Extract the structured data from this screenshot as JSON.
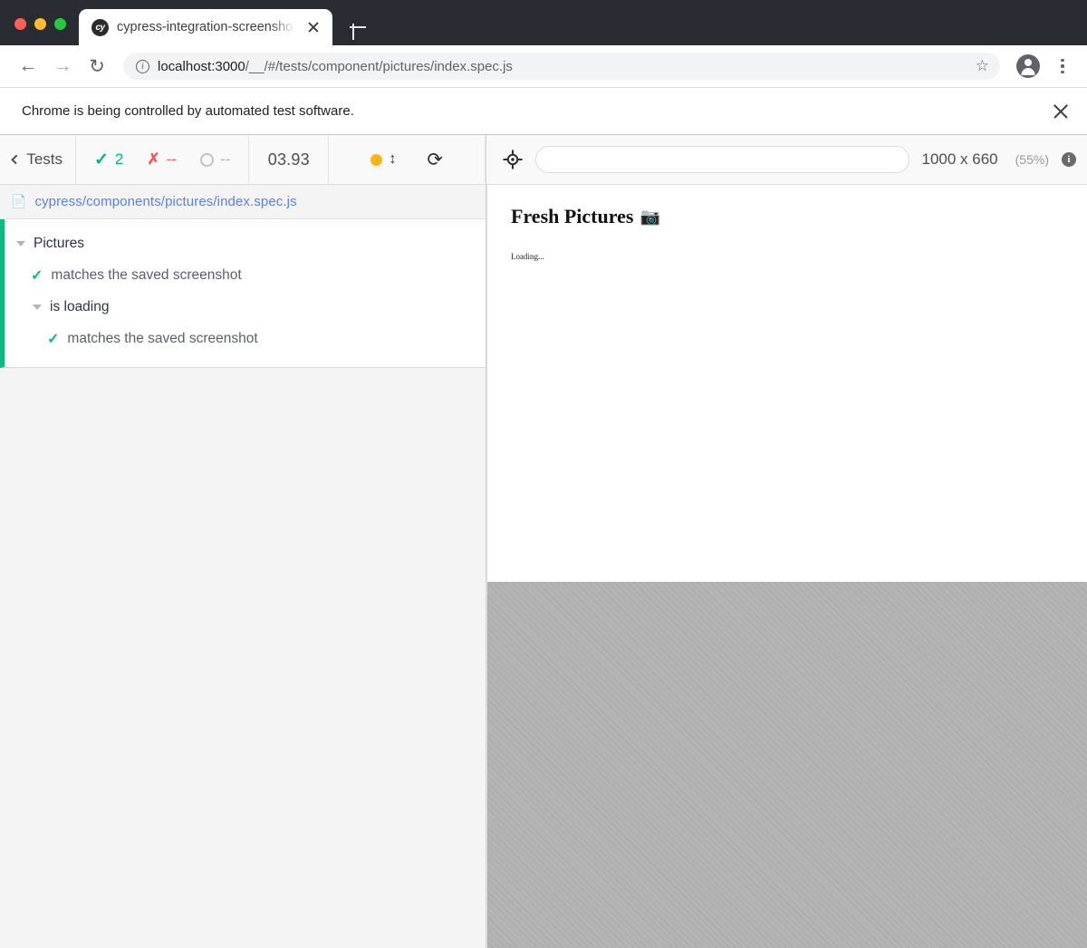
{
  "browser": {
    "tab": {
      "title": "cypress-integration-screensho",
      "favicon": "cy"
    },
    "new_tab_label": "+",
    "url": {
      "host": "localhost:3000",
      "path": "/__/#/tests/component/pictures/index.spec.js"
    },
    "notification": {
      "text": "Chrome is being controlled by automated test software."
    }
  },
  "runner": {
    "back_label": "Tests",
    "stats": {
      "passed": "2",
      "failed": "--",
      "pending": "--",
      "timer": "03.93"
    },
    "spec_file": "cypress/components/pictures/index.spec.js",
    "tree": [
      {
        "type": "suite",
        "label": "Pictures",
        "depth": 0
      },
      {
        "type": "test",
        "label": "matches the saved screenshot",
        "depth": 0,
        "state": "passed"
      },
      {
        "type": "suite",
        "label": "is loading",
        "depth": 1
      },
      {
        "type": "test",
        "label": "matches the saved screenshot",
        "depth": 1,
        "state": "passed"
      }
    ],
    "viewport": {
      "size": "1000 x 660",
      "scale": "(55%)"
    },
    "selector_input_value": "",
    "selector_input_placeholder": ""
  },
  "app": {
    "title": "Fresh Pictures",
    "title_emoji": "📷",
    "loading_text": "Loading..."
  },
  "colors": {
    "pass_green": "#0fba81",
    "fail_red": "#f05b5b",
    "link_blue": "#5b7fe8",
    "amber": "#fcb316",
    "tabbar_dark": "#292c33"
  }
}
